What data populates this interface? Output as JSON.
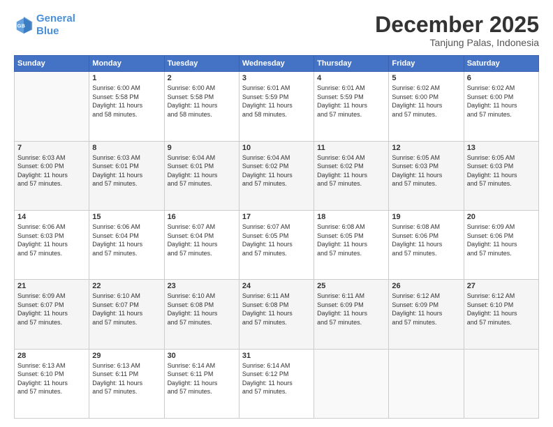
{
  "header": {
    "logo_line1": "General",
    "logo_line2": "Blue",
    "title": "December 2025",
    "subtitle": "Tanjung Palas, Indonesia"
  },
  "weekdays": [
    "Sunday",
    "Monday",
    "Tuesday",
    "Wednesday",
    "Thursday",
    "Friday",
    "Saturday"
  ],
  "weeks": [
    [
      {
        "day": "",
        "info": ""
      },
      {
        "day": "1",
        "info": "Sunrise: 6:00 AM\nSunset: 5:58 PM\nDaylight: 11 hours\nand 58 minutes."
      },
      {
        "day": "2",
        "info": "Sunrise: 6:00 AM\nSunset: 5:58 PM\nDaylight: 11 hours\nand 58 minutes."
      },
      {
        "day": "3",
        "info": "Sunrise: 6:01 AM\nSunset: 5:59 PM\nDaylight: 11 hours\nand 58 minutes."
      },
      {
        "day": "4",
        "info": "Sunrise: 6:01 AM\nSunset: 5:59 PM\nDaylight: 11 hours\nand 57 minutes."
      },
      {
        "day": "5",
        "info": "Sunrise: 6:02 AM\nSunset: 6:00 PM\nDaylight: 11 hours\nand 57 minutes."
      },
      {
        "day": "6",
        "info": "Sunrise: 6:02 AM\nSunset: 6:00 PM\nDaylight: 11 hours\nand 57 minutes."
      }
    ],
    [
      {
        "day": "7",
        "info": "Sunrise: 6:03 AM\nSunset: 6:00 PM\nDaylight: 11 hours\nand 57 minutes."
      },
      {
        "day": "8",
        "info": "Sunrise: 6:03 AM\nSunset: 6:01 PM\nDaylight: 11 hours\nand 57 minutes."
      },
      {
        "day": "9",
        "info": "Sunrise: 6:04 AM\nSunset: 6:01 PM\nDaylight: 11 hours\nand 57 minutes."
      },
      {
        "day": "10",
        "info": "Sunrise: 6:04 AM\nSunset: 6:02 PM\nDaylight: 11 hours\nand 57 minutes."
      },
      {
        "day": "11",
        "info": "Sunrise: 6:04 AM\nSunset: 6:02 PM\nDaylight: 11 hours\nand 57 minutes."
      },
      {
        "day": "12",
        "info": "Sunrise: 6:05 AM\nSunset: 6:03 PM\nDaylight: 11 hours\nand 57 minutes."
      },
      {
        "day": "13",
        "info": "Sunrise: 6:05 AM\nSunset: 6:03 PM\nDaylight: 11 hours\nand 57 minutes."
      }
    ],
    [
      {
        "day": "14",
        "info": "Sunrise: 6:06 AM\nSunset: 6:03 PM\nDaylight: 11 hours\nand 57 minutes."
      },
      {
        "day": "15",
        "info": "Sunrise: 6:06 AM\nSunset: 6:04 PM\nDaylight: 11 hours\nand 57 minutes."
      },
      {
        "day": "16",
        "info": "Sunrise: 6:07 AM\nSunset: 6:04 PM\nDaylight: 11 hours\nand 57 minutes."
      },
      {
        "day": "17",
        "info": "Sunrise: 6:07 AM\nSunset: 6:05 PM\nDaylight: 11 hours\nand 57 minutes."
      },
      {
        "day": "18",
        "info": "Sunrise: 6:08 AM\nSunset: 6:05 PM\nDaylight: 11 hours\nand 57 minutes."
      },
      {
        "day": "19",
        "info": "Sunrise: 6:08 AM\nSunset: 6:06 PM\nDaylight: 11 hours\nand 57 minutes."
      },
      {
        "day": "20",
        "info": "Sunrise: 6:09 AM\nSunset: 6:06 PM\nDaylight: 11 hours\nand 57 minutes."
      }
    ],
    [
      {
        "day": "21",
        "info": "Sunrise: 6:09 AM\nSunset: 6:07 PM\nDaylight: 11 hours\nand 57 minutes."
      },
      {
        "day": "22",
        "info": "Sunrise: 6:10 AM\nSunset: 6:07 PM\nDaylight: 11 hours\nand 57 minutes."
      },
      {
        "day": "23",
        "info": "Sunrise: 6:10 AM\nSunset: 6:08 PM\nDaylight: 11 hours\nand 57 minutes."
      },
      {
        "day": "24",
        "info": "Sunrise: 6:11 AM\nSunset: 6:08 PM\nDaylight: 11 hours\nand 57 minutes."
      },
      {
        "day": "25",
        "info": "Sunrise: 6:11 AM\nSunset: 6:09 PM\nDaylight: 11 hours\nand 57 minutes."
      },
      {
        "day": "26",
        "info": "Sunrise: 6:12 AM\nSunset: 6:09 PM\nDaylight: 11 hours\nand 57 minutes."
      },
      {
        "day": "27",
        "info": "Sunrise: 6:12 AM\nSunset: 6:10 PM\nDaylight: 11 hours\nand 57 minutes."
      }
    ],
    [
      {
        "day": "28",
        "info": "Sunrise: 6:13 AM\nSunset: 6:10 PM\nDaylight: 11 hours\nand 57 minutes."
      },
      {
        "day": "29",
        "info": "Sunrise: 6:13 AM\nSunset: 6:11 PM\nDaylight: 11 hours\nand 57 minutes."
      },
      {
        "day": "30",
        "info": "Sunrise: 6:14 AM\nSunset: 6:11 PM\nDaylight: 11 hours\nand 57 minutes."
      },
      {
        "day": "31",
        "info": "Sunrise: 6:14 AM\nSunset: 6:12 PM\nDaylight: 11 hours\nand 57 minutes."
      },
      {
        "day": "",
        "info": ""
      },
      {
        "day": "",
        "info": ""
      },
      {
        "day": "",
        "info": ""
      }
    ]
  ]
}
